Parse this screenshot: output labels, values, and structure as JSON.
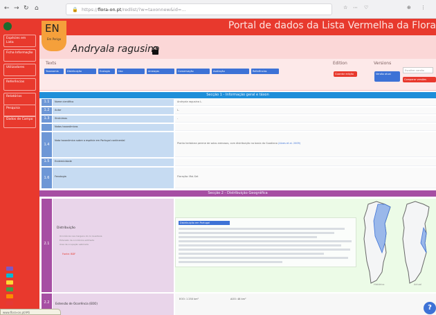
{
  "browser": {
    "nav_back": "←",
    "nav_forward": "→",
    "nav_reload": "↻",
    "nav_home": "⌂",
    "url_host": "flora-on.pt",
    "url_prefix": "https://",
    "url_path": "/redlist/?w=taxonnew&id=...",
    "lock_glyph": "🔒",
    "right_items": [
      "☆",
      "⋯",
      "♡",
      "⊕",
      "⋮"
    ]
  },
  "header": {
    "portal_title": "Portal de dados da Lista Vermelha da Flora",
    "category_code": "EN",
    "category_label": "Em Perigo",
    "species_name": "Andryala ragusina",
    "brand_color": "#e8392d"
  },
  "sidebar": {
    "items": [
      "Espécies em Lista",
      "Ficha Informação",
      "Utilizadores",
      "Referências",
      "Relatórios",
      "Pesquisa",
      "Dados de Campo"
    ],
    "status_squares": [
      "#7e57c2",
      "#00b8d4",
      "#fdd835",
      "#43a047",
      "#fb8c00",
      "#e53935"
    ]
  },
  "tabs": {
    "label": "Texts",
    "buttons": [
      "Taxonomia",
      "Distribuição",
      "Ecologia",
      "Uso",
      "Ameaças",
      "Conservação",
      "Avaliação",
      "Referências"
    ]
  },
  "edition": {
    "label": "Edition",
    "button": "Guardar edição"
  },
  "versions": {
    "label": "Versions",
    "current_button": "Versão atual",
    "select_placeholder": "Escolher versão",
    "compare_button": "Comparar versões"
  },
  "section1": {
    "title": "Secção 1 - Informação geral e táxon",
    "rows": [
      {
        "num": "1.1",
        "label": "Nome científico",
        "value": "Andryala ragusina L."
      },
      {
        "num": "1.2",
        "label": "Autor",
        "value": "L."
      },
      {
        "num": "1.3",
        "label": "Sinónimos",
        "value": "-"
      },
      {
        "num": "",
        "label": "Notas taxonómicas",
        "value": ""
      },
      {
        "num": "1.4",
        "label": "Nota taxonómica sobre a espécie em Portugal continental",
        "value": "Planta herbácea perene de solos arenosos, com distribuição na bacia do Guadiana",
        "ref": "(Alves et al. 2009)"
      },
      {
        "num": "1.5",
        "label": "Endemicidade",
        "value": ""
      },
      {
        "num": "1.6",
        "label": "Fenologia",
        "value": "Floração: Mai-Set"
      }
    ]
  },
  "section2": {
    "title": "Secção 2 - Distribuição Geográfica",
    "num": "2.1",
    "label": "Distribuição",
    "notes": [
      "Ocorrência nas margens do rio Guadiana",
      "Extensão de ocorrência estimada",
      "Área de ocupação estimada"
    ],
    "ref": "Fonte: BDF",
    "box_title": "Distribuição em Portugal",
    "map_labels": [
      "Histórico",
      "Actual"
    ]
  },
  "section3": {
    "num": "2.2",
    "label": "Extensão de Ocorrência (EOO)",
    "values": [
      "EOO: 1 250 km²",
      "AOO: 48 km²"
    ]
  },
  "help_glyph": "?",
  "status_tip": "www.flora-on.pt/#6"
}
